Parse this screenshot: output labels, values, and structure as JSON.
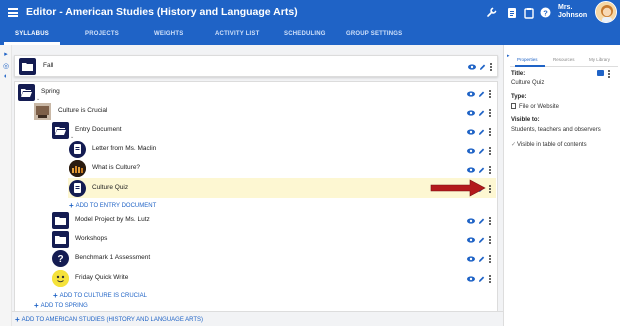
{
  "header": {
    "title": "Editor - American Studies (History and Language Arts)",
    "user_first": "Mrs.",
    "user_last": "Johnson",
    "icons": [
      "wrench-icon",
      "document-icon",
      "clipboard-icon",
      "help-icon"
    ]
  },
  "tabs": [
    {
      "label": "SYLLABUS",
      "active": true
    },
    {
      "label": "PROJECTS",
      "active": false
    },
    {
      "label": "WEIGHTS",
      "active": false
    },
    {
      "label": "ACTIVITY LIST",
      "active": false
    },
    {
      "label": "SCHEDULING",
      "active": false
    },
    {
      "label": "GROUP SETTINGS",
      "active": false
    }
  ],
  "tree": {
    "fall": "Fall",
    "spring": "Spring",
    "culture_is_crucial": "Culture is Crucial",
    "entry_document": "Entry Document",
    "letter": "Letter from Ms. Maclin",
    "what_is_culture": "What is Culture?",
    "culture_quiz": "Culture Quiz",
    "add_entry": "ADD TO ENTRY DOCUMENT",
    "model_project": "Model Project by Ms. Lutz",
    "workshops": "Workshops",
    "benchmark": "Benchmark 1 Assessment",
    "friday": "Friday Quick Write",
    "add_culture": "ADD TO CULTURE IS CRUCIAL",
    "add_spring": "ADD TO SPRING",
    "add_course": "ADD TO AMERICAN STUDIES (HISTORY AND LANGUAGE ARTS)"
  },
  "panel": {
    "tabs": [
      "Properties",
      "Resources",
      "My Library"
    ],
    "title_label": "Title:",
    "title_value": "Culture Quiz",
    "type_label": "Type:",
    "type_value": "File or Website",
    "visible_label": "Visible to:",
    "visible_value": "Students, teachers and observers",
    "toc_label": "Visible in table of contents"
  },
  "colors": {
    "brand": "#1f63c6",
    "icon_bg": "#141c52",
    "highlight": "#fdf7d2",
    "arrow": "#b3191c"
  }
}
